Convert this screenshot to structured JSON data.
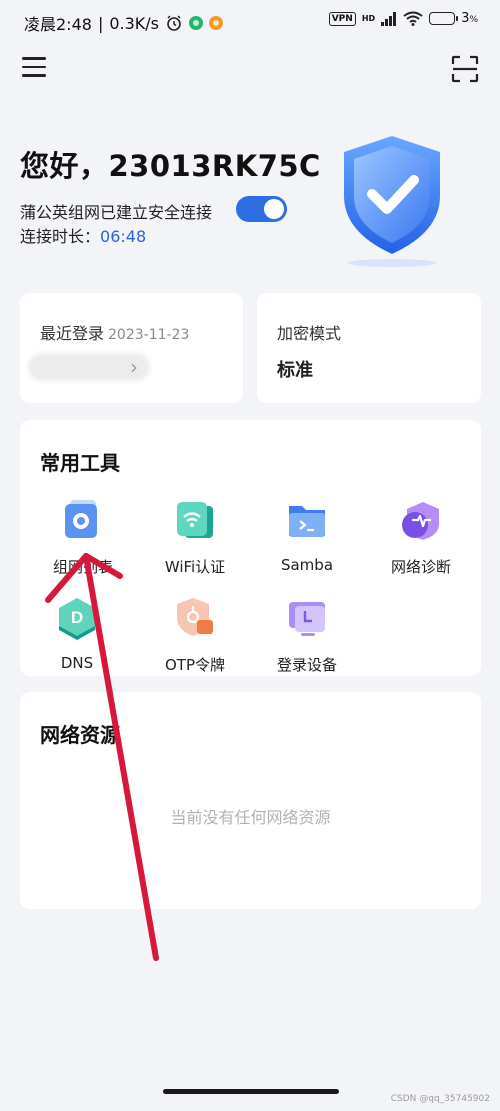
{
  "status_bar": {
    "time": "凌晨2:48",
    "speed": "0.3K/s",
    "vpn": "VPN",
    "network": "HD",
    "battery": "3"
  },
  "header": {
    "menu_icon": "menu-icon",
    "scan_icon": "scan-icon"
  },
  "greeting": {
    "title": "您好，23013RK75C",
    "connection_text": "蒲公英组网已建立安全连接",
    "duration_label": "连接时长：",
    "duration_value": "06:48",
    "toggle_on": true
  },
  "login_card": {
    "label": "最近登录",
    "date": "2023-11-23"
  },
  "encryption_card": {
    "label": "加密模式",
    "value": "标准"
  },
  "tools": {
    "title": "常用工具",
    "items": [
      {
        "label": "组网列表",
        "icon": "network-list-icon"
      },
      {
        "label": "WiFi认证",
        "icon": "wifi-auth-icon"
      },
      {
        "label": "Samba",
        "icon": "samba-folder-icon"
      },
      {
        "label": "网络诊断",
        "icon": "network-diagnosis-icon"
      },
      {
        "label": "DNS",
        "icon": "dns-icon"
      },
      {
        "label": "OTP令牌",
        "icon": "otp-token-icon"
      },
      {
        "label": "登录设备",
        "icon": "login-device-icon"
      }
    ]
  },
  "resources": {
    "title": "网络资源",
    "empty_text": "当前没有任何网络资源"
  },
  "watermark": "CSDN @qq_35745902",
  "colors": {
    "accent": "#2f6de4",
    "annotation_arrow": "#d6183c",
    "background": "#f3f4f8"
  }
}
